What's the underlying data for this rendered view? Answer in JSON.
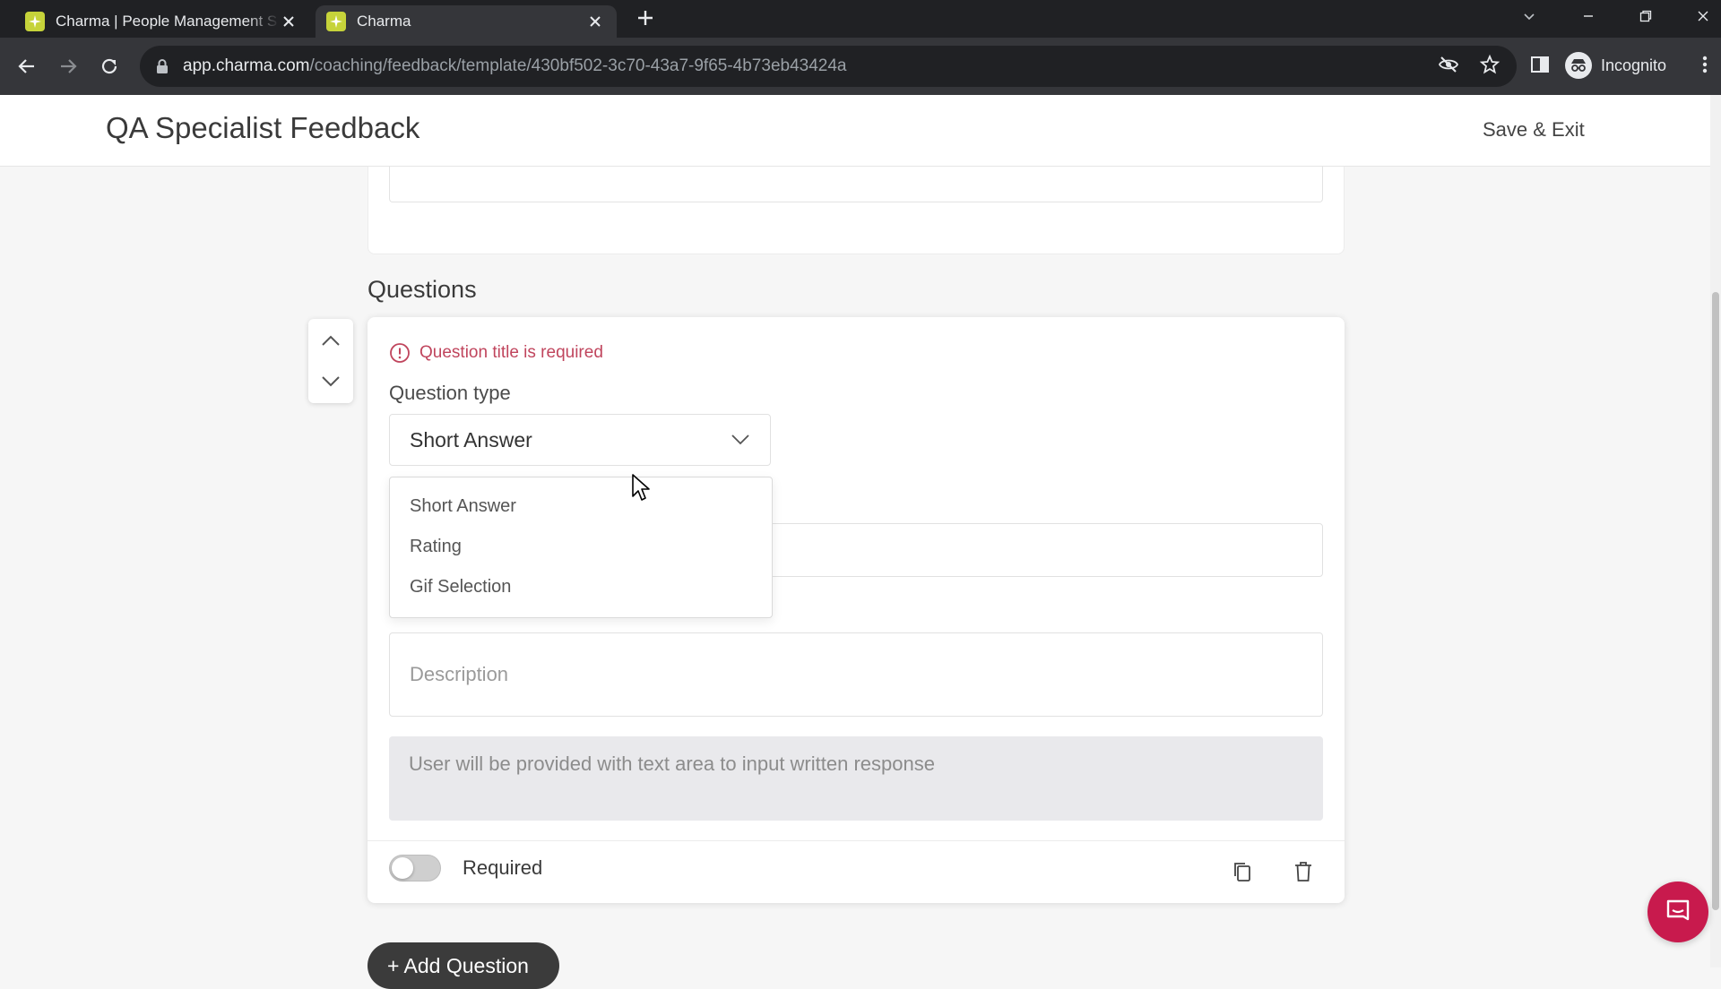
{
  "browser": {
    "tabs": [
      {
        "title": "Charma | People Management S",
        "active": false
      },
      {
        "title": "Charma",
        "active": true
      }
    ],
    "url_host": "app.charma.com",
    "url_path": "/coaching/feedback/template/430bf502-3c70-43a7-9f65-4b73eb43424a",
    "profile_label": "Incognito"
  },
  "header": {
    "title": "QA Specialist Feedback",
    "save_exit": "Save & Exit"
  },
  "questions_section": {
    "title": "Questions",
    "error": "Question title is required",
    "question_type_label": "Question type",
    "question_type_value": "Short Answer",
    "question_type_options": [
      "Short Answer",
      "Rating",
      "Gif Selection"
    ],
    "description_placeholder": "Description",
    "response_preview": "User will be provided with text area to input written response",
    "required_label": "Required",
    "required_on": false
  },
  "add_question": "+ Add Question",
  "colors": {
    "brand": "#c81a4d",
    "error": "#c0455d",
    "favicon": "#c6d33a"
  }
}
